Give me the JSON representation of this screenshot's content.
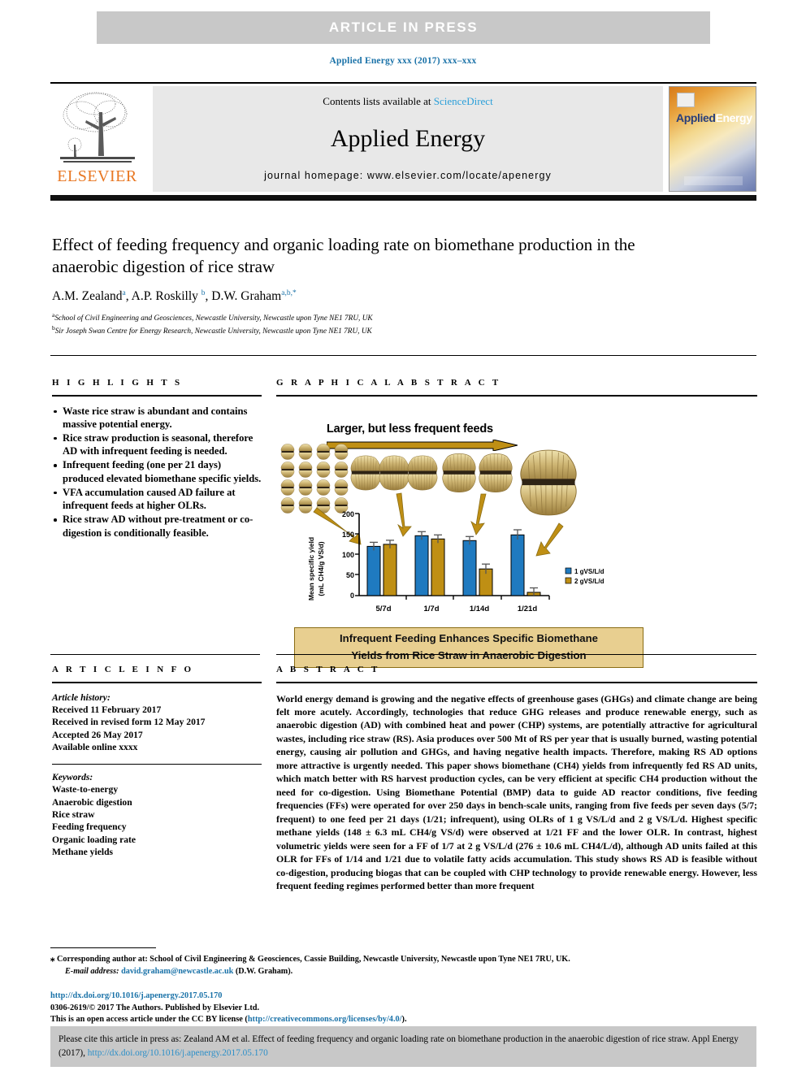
{
  "banner": {
    "text": "ARTICLE  IN  PRESS"
  },
  "journal_ref": "Applied Energy xxx (2017) xxx–xxx",
  "masthead": {
    "contents_prefix": "Contents lists available at ",
    "contents_link": "ScienceDirect",
    "journal_title": "Applied Energy",
    "homepage": "journal homepage: www.elsevier.com/locate/apenergy",
    "publisher_name": "ELSEVIER",
    "cover_title_first": "Applied",
    "cover_title_second": "Energy"
  },
  "article": {
    "title": "Effect of feeding frequency and organic loading rate on biomethane production in the anaerobic digestion of rice straw",
    "authors_html": "A.M. Zealand a, A.P. Roskilly b, D.W. Graham a,b,*",
    "author_list": [
      {
        "name": "A.M. Zealand",
        "marks": "a"
      },
      {
        "name": "A.P. Roskilly",
        "marks": "b"
      },
      {
        "name": "D.W. Graham",
        "marks": "a,b,*"
      }
    ],
    "affiliations": [
      {
        "mark": "a",
        "text": "School of Civil Engineering and Geosciences, Newcastle University, Newcastle upon Tyne NE1 7RU, UK"
      },
      {
        "mark": "b",
        "text": "Sir Joseph Swan Centre for Energy Research, Newcastle University, Newcastle upon Tyne NE1 7RU, UK"
      }
    ]
  },
  "highlights": {
    "heading": "H I G H L I G H T S",
    "items": [
      "Waste rice straw is abundant and contains massive potential energy.",
      "Rice straw production is seasonal, therefore AD with infrequent feeding is needed.",
      "Infrequent feeding (one per 21 days) produced elevated biomethane specific yields.",
      "VFA accumulation caused AD failure at infrequent feeds at higher OLRs.",
      "Rice straw AD without pre-treatment or co-digestion is conditionally feasible."
    ]
  },
  "graphical_abstract": {
    "heading": "G R A P H I C A L   A B S T R A C T",
    "arrow_label": "Larger, but less frequent feeds",
    "callout_line1": "Infrequent Feeding Enhances Specific Biomethane",
    "callout_line2": "Yields from Rice Straw in Anaerobic Digestion",
    "colors": {
      "series1": "#1f7ac0",
      "series2": "#bf8f14",
      "arrow": "#bf8f14",
      "callout_fill": "#e8cf90",
      "callout_border": "#8a6d15"
    }
  },
  "chart_data": {
    "type": "bar",
    "title": "",
    "xlabel": "",
    "ylabel": "Mean specific yield (mL CH4/g VS/d)",
    "ylabel_line1": "Mean specific  yield",
    "ylabel_line2": "(mL CH4/g VS/d)",
    "categories": [
      "5/7d",
      "1/7d",
      "1/14d",
      "1/21d"
    ],
    "ylim": [
      0,
      200
    ],
    "yticks": [
      0,
      50,
      100,
      150,
      200
    ],
    "ytick_labels": [
      "0",
      "50",
      "100",
      "150",
      "200"
    ],
    "grid": false,
    "legend_position": "right",
    "series": [
      {
        "name": "1 gVS/L/d",
        "color": "#1f7ac0",
        "values": [
          120,
          146,
          134,
          148
        ],
        "errors": [
          5,
          5,
          5,
          6.3
        ]
      },
      {
        "name": "2 gVS/L/d",
        "color": "#bf8f14",
        "values": [
          125,
          138,
          65,
          8
        ],
        "errors": [
          5,
          5,
          6,
          5
        ]
      }
    ]
  },
  "article_info": {
    "heading": "A R T I C L E   I N F O",
    "history_label": "Article history:",
    "history": [
      "Received 11 February 2017",
      "Received in revised form 12 May 2017",
      "Accepted 26 May 2017",
      "Available online xxxx"
    ],
    "keywords_label": "Keywords:",
    "keywords": [
      "Waste-to-energy",
      "Anaerobic digestion",
      "Rice straw",
      "Feeding frequency",
      "Organic loading rate",
      "Methane yields"
    ]
  },
  "abstract": {
    "heading": "A B S T R A C T",
    "text": "World energy demand is growing and the negative effects of greenhouse gases (GHGs) and climate change are being felt more acutely. Accordingly, technologies that reduce GHG releases and produce renewable energy, such as anaerobic digestion (AD) with combined heat and power (CHP) systems, are potentially attractive for agricultural wastes, including rice straw (RS). Asia produces over 500 Mt of RS per year that is usually burned, wasting potential energy, causing air pollution and GHGs, and having negative health impacts. Therefore, making RS AD options more attractive is urgently needed. This paper shows biomethane (CH4) yields from infrequently fed RS AD units, which match better with RS harvest production cycles, can be very efficient at specific CH4 production without the need for co-digestion. Using Biomethane Potential (BMP) data to guide AD reactor conditions, five feeding frequencies (FFs) were operated for over 250 days in bench-scale units, ranging from five feeds per seven days (5/7; frequent) to one feed per 21 days (1/21; infrequent), using OLRs of 1 g VS/L/d and 2 g VS/L/d. Highest specific methane yields (148 ± 6.3 mL CH4/g VS/d) were observed at 1/21 FF and the lower OLR. In contrast, highest volumetric yields were seen for a FF of 1/7 at 2 g VS/L/d (276 ± 10.6 mL CH4/L/d), although AD units failed at this OLR for FFs of 1/14 and 1/21 due to volatile fatty acids accumulation. This study shows RS AD is feasible without co-digestion, producing biogas that can be coupled with CHP technology to provide renewable energy. However, less frequent feeding regimes performed better than more frequent"
  },
  "footer": {
    "corresponding_star": "⁎",
    "corresponding_text": "Corresponding author at: School of Civil Engineering & Geosciences, Cassie Building, Newcastle University, Newcastle upon Tyne NE1 7RU, UK.",
    "email_label": "E-mail address:",
    "email": "david.graham@newcastle.ac.uk",
    "email_owner": "(D.W. Graham).",
    "doi_url": "http://dx.doi.org/10.1016/j.apenergy.2017.05.170",
    "issn_line": "0306-2619/© 2017 The Authors. Published by Elsevier Ltd.",
    "license_prefix": "This is an open access article under the CC BY license (",
    "license_url": "http://creativecommons.org/licenses/by/4.0/",
    "license_suffix": ").",
    "cite_prefix": "Please cite this article in press as: Zealand AM et al. Effect of feeding frequency and organic loading rate on biomethane production in the anaerobic digestion of rice straw. Appl Energy (2017), ",
    "cite_doi": "http://dx.doi.org/10.1016/j.apenergy.2017.05.170"
  }
}
